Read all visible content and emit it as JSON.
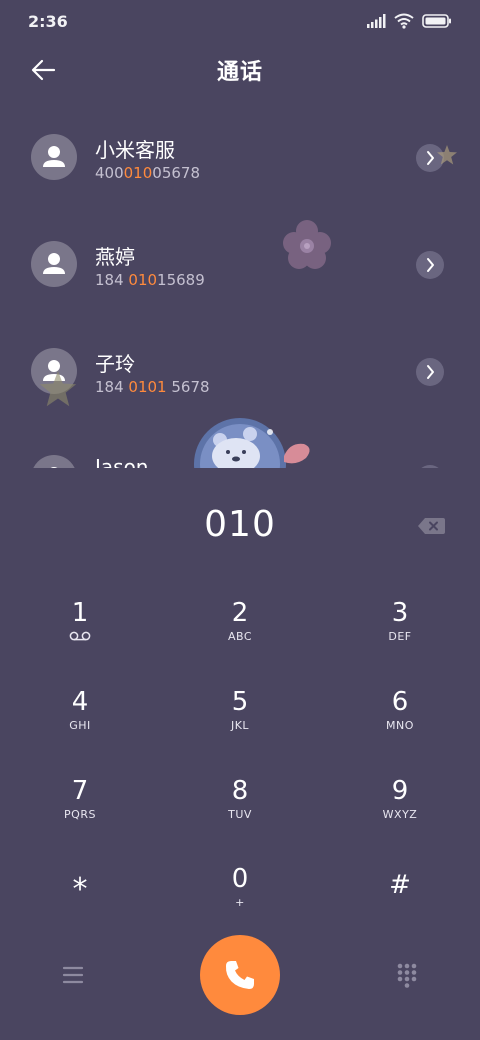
{
  "status_bar": {
    "time": "2:36"
  },
  "header": {
    "title": "通话"
  },
  "contacts": [
    {
      "name": "小米客服",
      "number_pre": "400",
      "number_match": "010",
      "number_post": "05678"
    },
    {
      "name": "燕婷",
      "number_pre": "184 ",
      "number_match": "010",
      "number_post": "15689"
    },
    {
      "name": "子玲",
      "number_pre": "184 ",
      "number_match": "0101",
      "number_post": " 5678"
    },
    {
      "name": "Jason",
      "number_pre": "",
      "number_match": "",
      "number_post": ""
    }
  ],
  "dial": {
    "number": "010"
  },
  "keypad": [
    {
      "digit": "1",
      "letters": ""
    },
    {
      "digit": "2",
      "letters": "ABC"
    },
    {
      "digit": "3",
      "letters": "DEF"
    },
    {
      "digit": "4",
      "letters": "GHI"
    },
    {
      "digit": "5",
      "letters": "JKL"
    },
    {
      "digit": "6",
      "letters": "MNO"
    },
    {
      "digit": "7",
      "letters": "PQRS"
    },
    {
      "digit": "8",
      "letters": "TUV"
    },
    {
      "digit": "9",
      "letters": "WXYZ"
    },
    {
      "digit": "*",
      "letters": ""
    },
    {
      "digit": "0",
      "letters": "+"
    },
    {
      "digit": "#",
      "letters": ""
    }
  ],
  "colors": {
    "background": "#4a4560",
    "accent": "#ff8a3d",
    "avatar": "#7a768a"
  },
  "icons": {
    "back": "arrow-left-icon",
    "voicemail": "voicemail-icon",
    "backspace": "backspace-icon",
    "call": "phone-icon",
    "menu": "menu-icon",
    "keypad": "dialpad-icon"
  }
}
